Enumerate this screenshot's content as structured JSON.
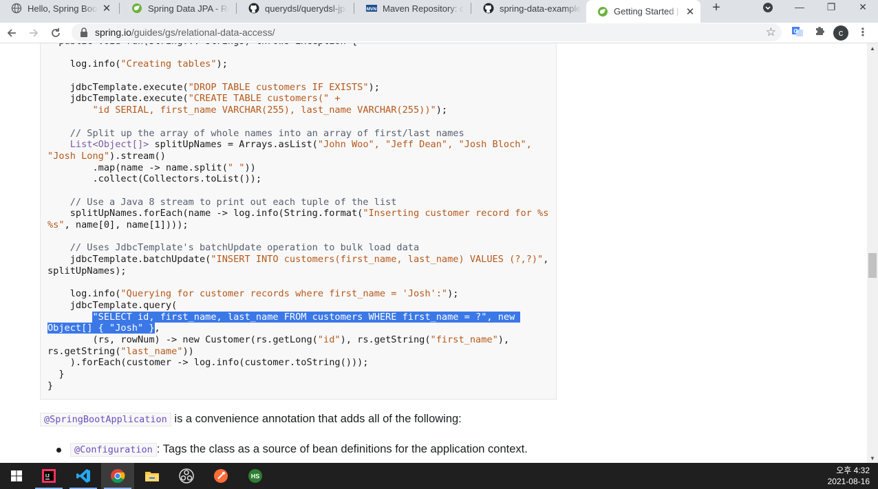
{
  "tabs": [
    {
      "title": "Hello, Spring Boot!",
      "icon": "globe-icon"
    },
    {
      "title": "Spring Data JPA - Ref",
      "icon": "spring-icon"
    },
    {
      "title": "querydsl/querydsl-jpa",
      "icon": "github-icon"
    },
    {
      "title": "Maven Repository: c",
      "icon": "mvn-icon"
    },
    {
      "title": "spring-data-examples",
      "icon": "github-icon"
    },
    {
      "title": "Getting Started | Acc",
      "icon": "spring-icon",
      "active": true
    }
  ],
  "address": {
    "host": "spring.io",
    "path": "/guides/gs/relational-data-access/"
  },
  "profile_initial": "c",
  "code_lines": [
    [
      {
        "t": "  public void run(String... strings) throws Exception {",
        "c": "k"
      }
    ],
    [
      {
        "t": "",
        "c": "k"
      }
    ],
    [
      {
        "t": "    log.info(",
        "c": "k"
      },
      {
        "t": "\"Creating tables\"",
        "c": "s"
      },
      {
        "t": ");",
        "c": "k"
      }
    ],
    [
      {
        "t": "",
        "c": "k"
      }
    ],
    [
      {
        "t": "    jdbcTemplate.execute(",
        "c": "k"
      },
      {
        "t": "\"DROP TABLE customers IF EXISTS\"",
        "c": "s"
      },
      {
        "t": ");",
        "c": "k"
      }
    ],
    [
      {
        "t": "    jdbcTemplate.execute(",
        "c": "k"
      },
      {
        "t": "\"CREATE TABLE customers(\" +",
        "c": "s"
      }
    ],
    [
      {
        "t": "        ",
        "c": "k"
      },
      {
        "t": "\"id SERIAL, first_name VARCHAR(255), last_name VARCHAR(255))\"",
        "c": "s"
      },
      {
        "t": ");",
        "c": "k"
      }
    ],
    [
      {
        "t": "",
        "c": "k"
      }
    ],
    [
      {
        "t": "    // Split up the array of whole names into an array of first/last names",
        "c": "c"
      }
    ],
    [
      {
        "t": "    List<Object[]> ",
        "c": "t"
      },
      {
        "t": "splitUpNames = Arrays.asList(",
        "c": "k"
      },
      {
        "t": "\"John Woo\", \"Jeff Dean\", \"Josh Bloch\",",
        "c": "s"
      }
    ],
    [
      {
        "t": "\"Josh Long\"",
        "c": "s"
      },
      {
        "t": ").stream()",
        "c": "k"
      }
    ],
    [
      {
        "t": "        .map(name -> name.split(",
        "c": "k"
      },
      {
        "t": "\" \"",
        "c": "s"
      },
      {
        "t": "))",
        "c": "k"
      }
    ],
    [
      {
        "t": "        .collect(Collectors.toList());",
        "c": "k"
      }
    ],
    [
      {
        "t": "",
        "c": "k"
      }
    ],
    [
      {
        "t": "    // Use a Java 8 stream to print out each tuple of the list",
        "c": "c"
      }
    ],
    [
      {
        "t": "    splitUpNames.forEach(name -> log.info(String.format(",
        "c": "k"
      },
      {
        "t": "\"Inserting customer record for %s",
        "c": "s"
      }
    ],
    [
      {
        "t": "%s\"",
        "c": "s"
      },
      {
        "t": ", name[0], name[1])));",
        "c": "k"
      }
    ],
    [
      {
        "t": "",
        "c": "k"
      }
    ],
    [
      {
        "t": "    // Uses JdbcTemplate's batchUpdate operation to bulk load data",
        "c": "c"
      }
    ],
    [
      {
        "t": "    jdbcTemplate.batchUpdate(",
        "c": "k"
      },
      {
        "t": "\"INSERT INTO customers(first_name, last_name) VALUES (?,?)\"",
        "c": "s"
      },
      {
        "t": ",",
        "c": "k"
      }
    ],
    [
      {
        "t": "splitUpNames);",
        "c": "k"
      }
    ],
    [
      {
        "t": "",
        "c": "k"
      }
    ],
    [
      {
        "t": "    log.info(",
        "c": "k"
      },
      {
        "t": "\"Querying for customer records where first_name = 'Josh':\"",
        "c": "s"
      },
      {
        "t": ");",
        "c": "k"
      }
    ],
    [
      {
        "t": "    jdbcTemplate.query(",
        "c": "k"
      }
    ],
    [
      {
        "t": "        ",
        "c": "k"
      },
      {
        "t": "\"SELECT id, first_name, last_name FROM customers WHERE first_name = ?\", new ",
        "c": "sel"
      }
    ],
    [
      {
        "t": "Object[] { \"Josh\" }",
        "c": "sel"
      },
      {
        "t": ",",
        "c": "k"
      }
    ],
    [
      {
        "t": "        (rs, rowNum) -> new Customer(rs.getLong(",
        "c": "k"
      },
      {
        "t": "\"id\"",
        "c": "s"
      },
      {
        "t": "), rs.getString(",
        "c": "k"
      },
      {
        "t": "\"first_name\"",
        "c": "s"
      },
      {
        "t": "),",
        "c": "k"
      }
    ],
    [
      {
        "t": "rs.getString(",
        "c": "k"
      },
      {
        "t": "\"last_name\"",
        "c": "s"
      },
      {
        "t": "))",
        "c": "k"
      }
    ],
    [
      {
        "t": "    ).forEach(customer -> log.info(customer.toString()));",
        "c": "k"
      }
    ],
    [
      {
        "t": "  }",
        "c": "k"
      }
    ],
    [
      {
        "t": "}",
        "c": "k"
      }
    ]
  ],
  "prose": {
    "annotation": "@SpringBootApplication",
    "annotation_text": " is a convenience annotation that adds all of the following:",
    "bullet1_code": "@Configuration",
    "bullet1_text": ": Tags the class as a source of bean definitions for the application context."
  },
  "taskbar": {
    "apps": [
      "start-icon",
      "intellij-icon",
      "vscode-icon",
      "chrome-icon",
      "file-explorer-icon",
      "obs-icon",
      "postman-icon",
      "hs-icon"
    ],
    "time": "오후 4:32",
    "date": "2021-08-16"
  }
}
